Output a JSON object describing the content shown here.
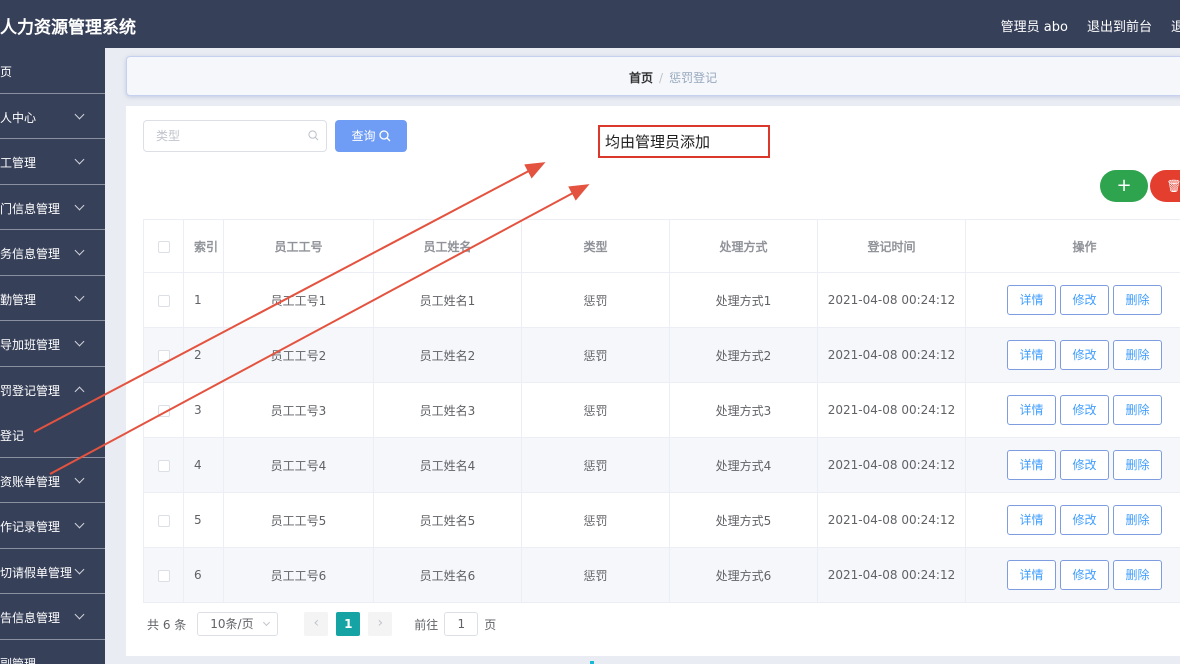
{
  "app": {
    "title": "人力资源管理系统",
    "admin_label": "管理员 abo",
    "exit_front_label": "退出到前台",
    "exit_label": "退出登"
  },
  "sidebar": {
    "items": [
      {
        "label": "页",
        "chevron": "none"
      },
      {
        "label": "人中心",
        "chevron": "down"
      },
      {
        "label": "工管理",
        "chevron": "down"
      },
      {
        "label": "门信息管理",
        "chevron": "down"
      },
      {
        "label": "务信息管理",
        "chevron": "down"
      },
      {
        "label": "勤管理",
        "chevron": "down"
      },
      {
        "label": "导加班管理",
        "chevron": "down"
      },
      {
        "label": "罚登记管理",
        "chevron": "up"
      },
      {
        "label": "登记",
        "chevron": "none"
      },
      {
        "label": "资账单管理",
        "chevron": "down"
      },
      {
        "label": "作记录管理",
        "chevron": "down"
      },
      {
        "label": "切请假单管理",
        "chevron": "down"
      },
      {
        "label": "告信息管理",
        "chevron": "down"
      },
      {
        "label": "副管理",
        "chevron": "none"
      }
    ]
  },
  "breadcrumb": {
    "home": "首页",
    "sep": "/",
    "current": "惩罚登记"
  },
  "search": {
    "placeholder": "类型",
    "button_label": "查询"
  },
  "actions": {
    "add_label": "+",
    "delete_label": "🗑"
  },
  "table": {
    "headers": [
      "索引",
      "员工工号",
      "员工姓名",
      "类型",
      "处理方式",
      "登记时间",
      "操作"
    ],
    "rows": [
      {
        "index": "1",
        "emp_no": "员工工号1",
        "emp_name": "员工姓名1",
        "type": "惩罚",
        "method": "处理方式1",
        "time": "2021-04-08 00:24:12"
      },
      {
        "index": "2",
        "emp_no": "员工工号2",
        "emp_name": "员工姓名2",
        "type": "惩罚",
        "method": "处理方式2",
        "time": "2021-04-08 00:24:12"
      },
      {
        "index": "3",
        "emp_no": "员工工号3",
        "emp_name": "员工姓名3",
        "type": "惩罚",
        "method": "处理方式3",
        "time": "2021-04-08 00:24:12"
      },
      {
        "index": "4",
        "emp_no": "员工工号4",
        "emp_name": "员工姓名4",
        "type": "惩罚",
        "method": "处理方式4",
        "time": "2021-04-08 00:24:12"
      },
      {
        "index": "5",
        "emp_no": "员工工号5",
        "emp_name": "员工姓名5",
        "type": "惩罚",
        "method": "处理方式5",
        "time": "2021-04-08 00:24:12"
      },
      {
        "index": "6",
        "emp_no": "员工工号6",
        "emp_name": "员工姓名6",
        "type": "惩罚",
        "method": "处理方式6",
        "time": "2021-04-08 00:24:12"
      }
    ],
    "row_actions": {
      "detail": "详情",
      "edit": "修改",
      "delete": "删除"
    }
  },
  "pagination": {
    "total_text": "共 6 条",
    "page_size": "10条/页",
    "current_page": "1",
    "prev": "‹",
    "next": "›",
    "goto_label": "前往",
    "goto_value": "1",
    "page_suffix": "页"
  },
  "annotation": {
    "text": "均由管理员添加",
    "color": "#d9382b"
  },
  "colors": {
    "topbar": "#374059",
    "primary": "#6f9cf5",
    "add": "#2ea44f",
    "danger": "#e43e2f",
    "active_page": "#16a3a3"
  }
}
